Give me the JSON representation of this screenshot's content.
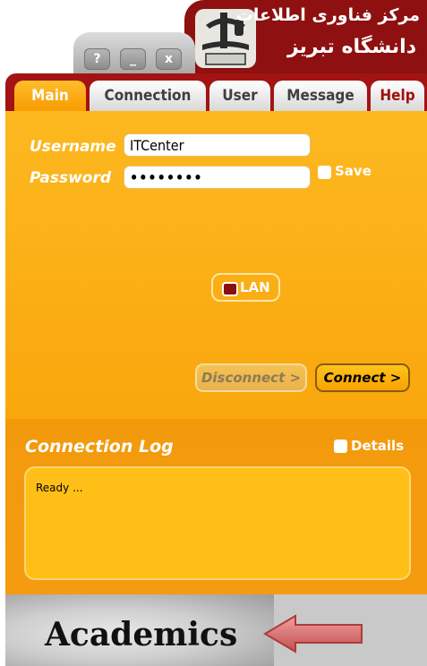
{
  "header": {
    "title_line1": "مرکز فناوری اطلاعات",
    "title_line2": "دانشگاه تبریز",
    "window_controls": [
      "?",
      "_",
      "x"
    ]
  },
  "tabs": [
    {
      "label": "Main",
      "active": true
    },
    {
      "label": "Connection",
      "active": false
    },
    {
      "label": "User",
      "active": false
    },
    {
      "label": "Message",
      "active": false
    },
    {
      "label": "Help",
      "active": false
    }
  ],
  "main": {
    "username_label": "Username",
    "username_value": "ITCenter",
    "password_label": "Password",
    "password_value": "••••••••",
    "save_label": "Save",
    "lan_label": "LAN",
    "disconnect_label": "Disconnect >",
    "connect_label": "Connect >"
  },
  "log": {
    "title": "Connection Log",
    "details_label": "Details",
    "text": "Ready ..."
  },
  "footer": {
    "title": "Academics"
  },
  "colors": {
    "brand_red": "#8e1010",
    "panel_orange": "#fdb820",
    "log_orange": "#f39a0c"
  }
}
